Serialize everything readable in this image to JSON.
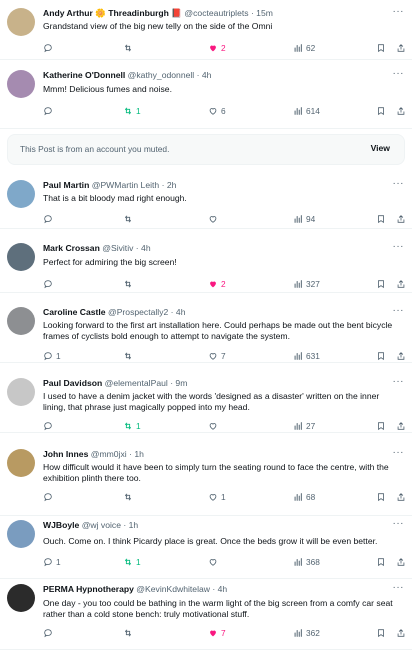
{
  "colors": {
    "like": "#f91880",
    "repost": "#00ba7c",
    "muted_bg": "#f7f9f9",
    "secondary": "#536471"
  },
  "posts": [
    {
      "name": "Andy Arthur 🌼 Threadinburgh 📕",
      "handle": "@cocteautriplets",
      "time": "· 15m",
      "text": "Grandstand view of the big new telly on the side of the Omni",
      "reposts": "",
      "likes": "2",
      "views": "62",
      "liked": true,
      "reposted": false
    },
    {
      "name": "Katherine O'Donnell",
      "handle": "@kathy_odonnell",
      "time": "· 4h",
      "text": "Mmm! Delicious fumes and noise.",
      "reposts": "1",
      "likes": "6",
      "views": "614",
      "liked": false,
      "reposted": true
    },
    {
      "name": "Paul Martin",
      "handle": "@PWMartin Leith",
      "time": "· 2h",
      "text": "That is a bit bloody mad right enough.",
      "reposts": "",
      "likes": "",
      "views": "94",
      "liked": false,
      "reposted": false
    },
    {
      "name": "Mark Crossan",
      "handle": "@Sivitiv",
      "time": "· 4h",
      "text": "Perfect for admiring the big screen!",
      "reposts": "",
      "likes": "2",
      "views": "327",
      "liked": true,
      "reposted": false
    },
    {
      "name": "Caroline Castle",
      "handle": "@Prospectally2",
      "time": "· 4h",
      "text": "Looking forward to the first art installation here. Could perhaps be made out the bent bicycle frames of cyclists bold enough to attempt to navigate the system.",
      "replies": "1",
      "reposts": "",
      "likes": "7",
      "views": "631",
      "liked": false,
      "reposted": false
    },
    {
      "name": "Paul Davidson",
      "handle": "@elementalPaul",
      "time": "· 9m",
      "text": "I used to have a denim jacket with the words 'designed as a disaster' written on the inner lining, that phrase just magically popped into my head.",
      "reposts": "1",
      "likes": "",
      "views": "27",
      "liked": false,
      "reposted": true
    },
    {
      "name": "John Innes",
      "handle": "@mm0jxi",
      "time": "· 1h",
      "text": "How difficult would it have been to simply turn the seating round to face the centre, with the exhibition plinth there too.",
      "reposts": "",
      "likes": "1",
      "views": "68",
      "liked": false,
      "reposted": false
    },
    {
      "name": "WJBoyle",
      "handle": "@wj voice",
      "time": "· 1h",
      "text": "Ouch. Come on. I think Picardy place is great. Once the beds grow it will be even better.",
      "replies": "1",
      "reposts": "1",
      "likes": "",
      "views": "368",
      "liked": false,
      "reposted": true
    },
    {
      "name": "PERMA Hypnotherapy",
      "handle": "@KevinKdwhitelaw",
      "time": "· 4h",
      "text": "One day - you too could be bathing in the warm light of the big screen from a comfy car seat rather than a cold stone bench: truly motivational stuff.",
      "reposts": "",
      "likes": "7",
      "views": "362",
      "liked": true,
      "reposted": false
    }
  ],
  "muted": {
    "text": "This Post is from an account you muted.",
    "button": "View"
  }
}
